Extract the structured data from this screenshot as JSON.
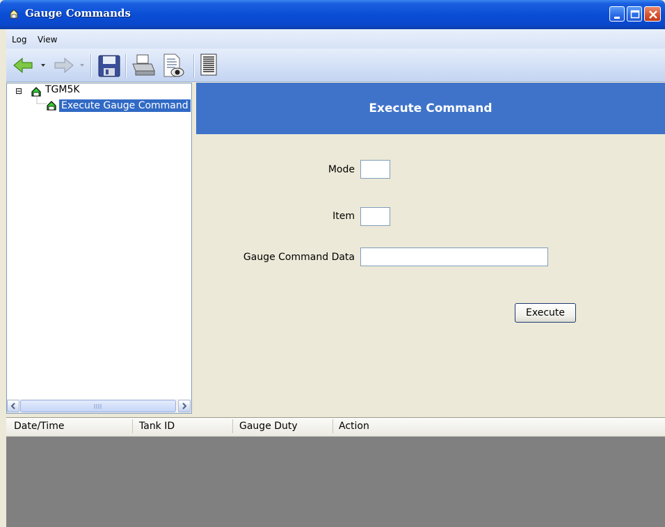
{
  "window": {
    "title": "Gauge Commands"
  },
  "menu": {
    "items": [
      "Log",
      "View"
    ]
  },
  "toolbar": {
    "icons": [
      "back-arrow-icon",
      "forward-arrow-icon",
      "save-icon",
      "print-icon",
      "print-preview-icon",
      "grid-view-icon"
    ]
  },
  "tree": {
    "root": {
      "label": "TGM5K",
      "expander": "⊟"
    },
    "child": {
      "label": "Execute Gauge Command"
    }
  },
  "panel": {
    "title": "Execute Command",
    "fields": {
      "mode": {
        "label": "Mode",
        "value": ""
      },
      "item": {
        "label": "Item",
        "value": ""
      },
      "gauge_command_data": {
        "label": "Gauge Command Data",
        "value": ""
      }
    },
    "execute_label": "Execute"
  },
  "log_table": {
    "columns": [
      "Date/Time",
      "Tank ID",
      "Gauge Duty",
      "Action"
    ]
  }
}
